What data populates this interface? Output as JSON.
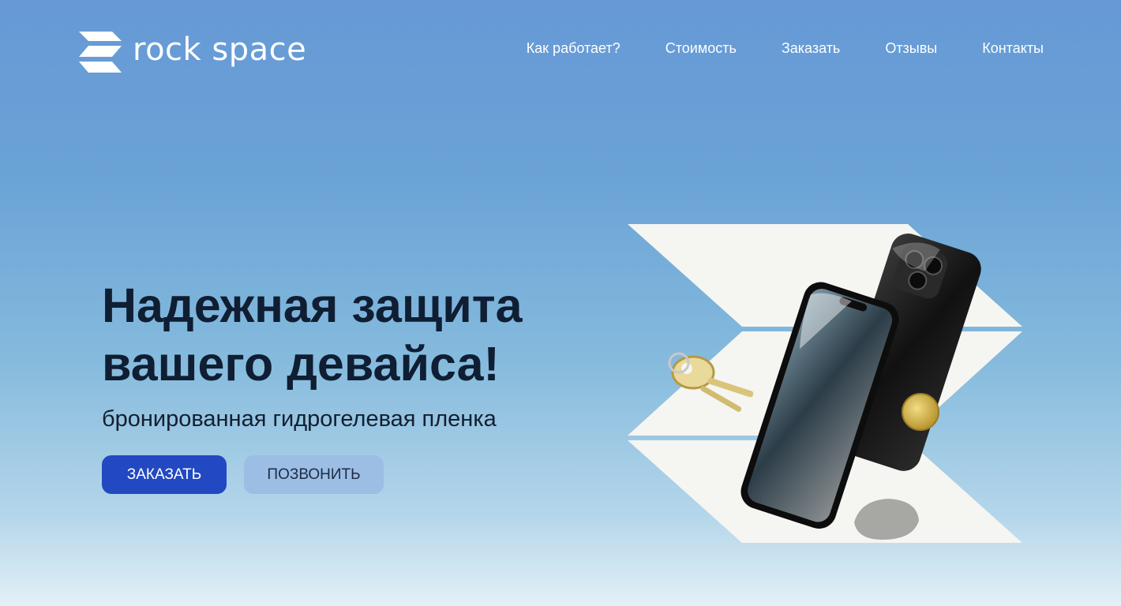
{
  "brand": {
    "name": "rock space",
    "logo_icon": "chevron-stack-icon"
  },
  "nav": {
    "items": [
      {
        "label": "Как работает?"
      },
      {
        "label": "Стоимость"
      },
      {
        "label": "Заказать"
      },
      {
        "label": "Отзывы"
      },
      {
        "label": "Контакты"
      }
    ]
  },
  "hero": {
    "title": "Надежная защита вашего девайса!",
    "subtitle": "бронированная гидрогелевая пленка",
    "primary_button": "ЗАКАЗАТЬ",
    "secondary_button": "ПОЗВОНИТЬ",
    "illustration": "phones-with-protective-film-keys-coin-stone"
  },
  "colors": {
    "background_top": "#6699d6",
    "background_bottom": "#e3f0f7",
    "primary_button": "#2249c1",
    "secondary_button": "#9cbde4",
    "title_text": "#0f1e33"
  }
}
